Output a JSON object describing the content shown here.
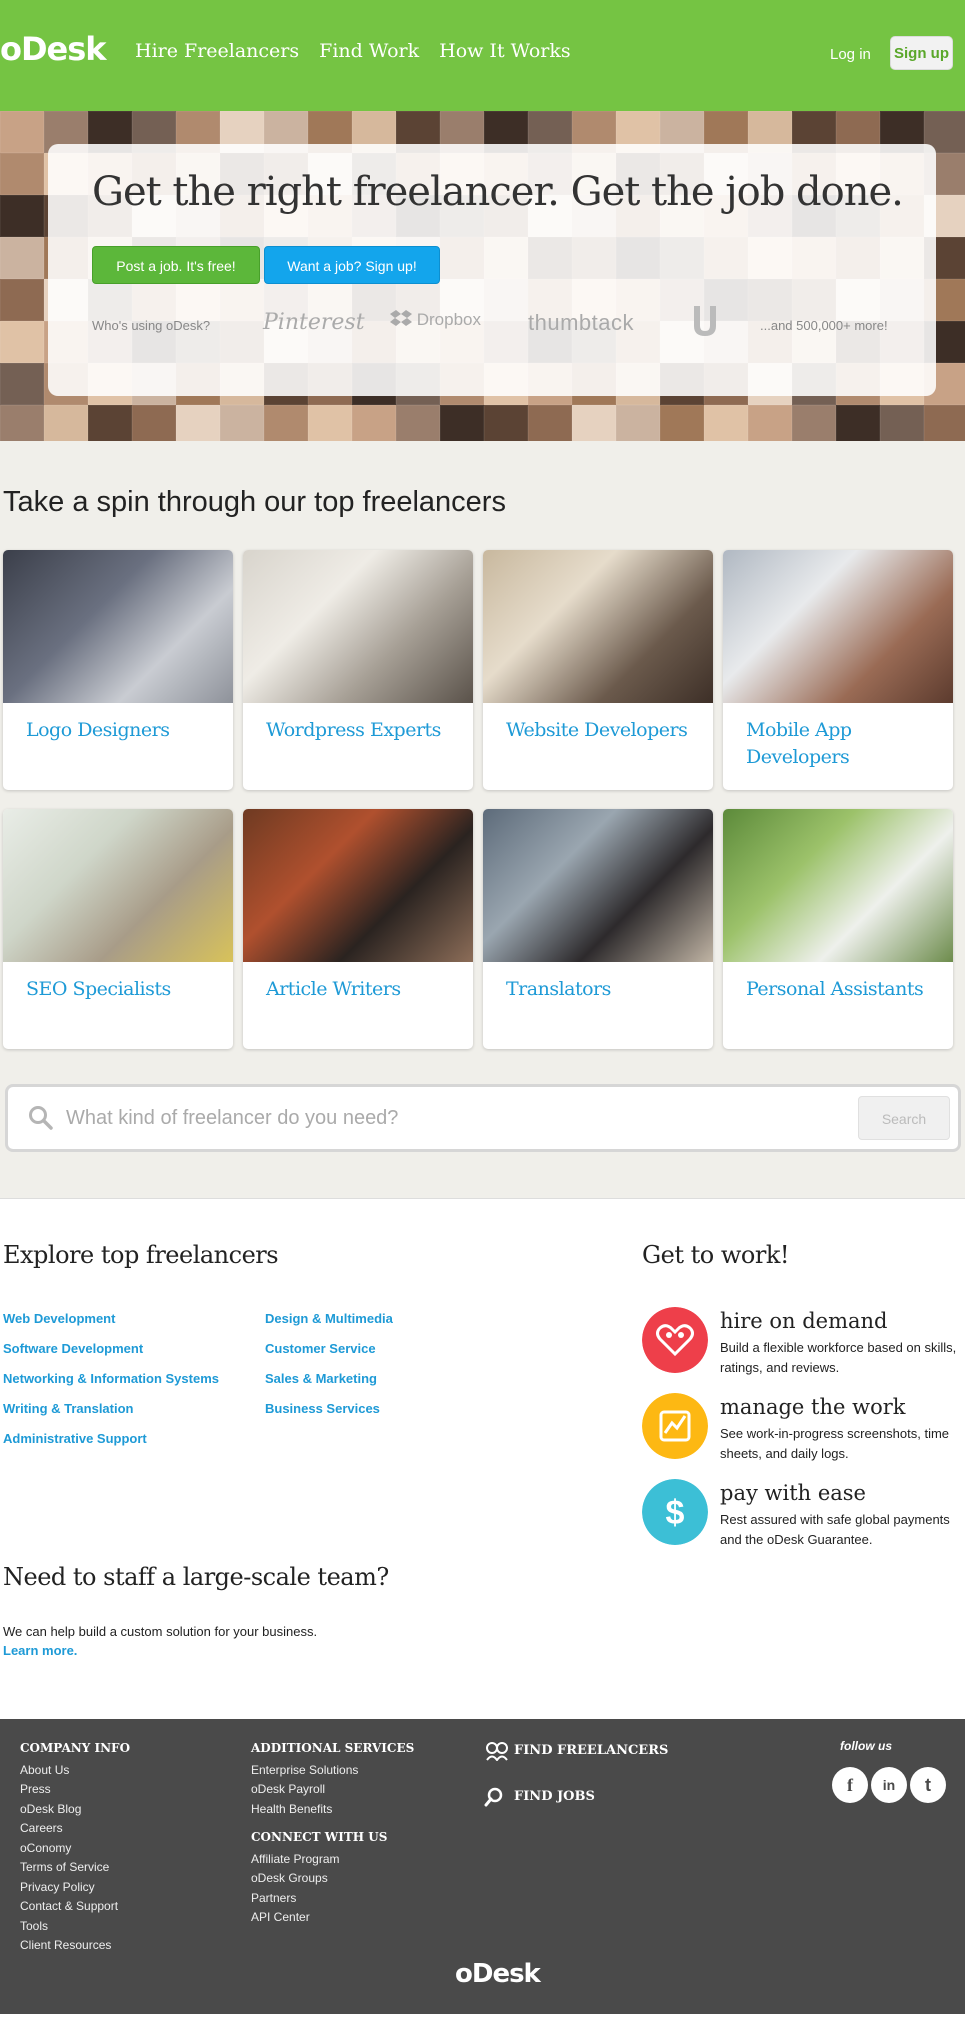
{
  "header": {
    "logo": "oDesk",
    "nav": [
      "Hire Freelancers",
      "Find Work",
      "How It Works"
    ],
    "login": "Log in",
    "signup": "Sign up"
  },
  "hero": {
    "title": "Get the right freelancer. Get the job done.",
    "post_button": "Post a job. It's free!",
    "want_button": "Want a job? Sign up!",
    "who": "Who's using oDesk?",
    "brands": [
      "Pinterest",
      "Dropbox",
      "thumbtack"
    ],
    "more": "...and 500,000+ more!"
  },
  "spin": {
    "title": "Take a spin through our top freelancers",
    "tiles": [
      "Logo Designers",
      "Wordpress Experts",
      "Website Developers",
      "Mobile App Developers",
      "SEO Specialists",
      "Article Writers",
      "Translators",
      "Personal Assistants"
    ]
  },
  "search": {
    "placeholder": "What kind of freelancer do you need?",
    "button": "Search"
  },
  "explore": {
    "title": "Explore top freelancers",
    "left": [
      "Web Development",
      "Software Development",
      "Networking & Information Systems",
      "Writing & Translation",
      "Administrative Support"
    ],
    "right": [
      "Design & Multimedia",
      "Customer Service",
      "Sales & Marketing",
      "Business Services"
    ]
  },
  "get_to_work": {
    "title": "Get to work!",
    "items": [
      {
        "title": "hire on demand",
        "desc": "Build a flexible workforce based on skills, ratings, and reviews.",
        "color": "#ee3f4a"
      },
      {
        "title": "manage the work",
        "desc": "See work-in-progress screenshots, time sheets, and daily logs.",
        "color": "#fdb813"
      },
      {
        "title": "pay with ease",
        "desc": "Rest assured with safe global payments and the oDesk Guarantee.",
        "color": "#3cbfd6"
      }
    ]
  },
  "staff": {
    "title": "Need to staff a large-scale team?",
    "desc": "We can help build a custom solution for your business.",
    "learn": "Learn more."
  },
  "footer": {
    "company_title": "COMPANY INFO",
    "company_links": [
      "About Us",
      "Press",
      "oDesk Blog",
      "Careers",
      "oConomy",
      "Terms of Service",
      "Privacy Policy",
      "Contact & Support",
      "Tools",
      "Client Resources"
    ],
    "additional_title": "ADDITIONAL SERVICES",
    "additional_links": [
      "Enterprise Solutions",
      "oDesk Payroll",
      "Health Benefits"
    ],
    "connect_title": "CONNECT WITH US",
    "connect_links": [
      "Affiliate Program",
      "oDesk Groups",
      "Partners",
      "API Center"
    ],
    "find_freelancers": "FIND FREELANCERS",
    "find_jobs": "FIND JOBS",
    "follow": "follow us",
    "logo": "oDesk"
  }
}
